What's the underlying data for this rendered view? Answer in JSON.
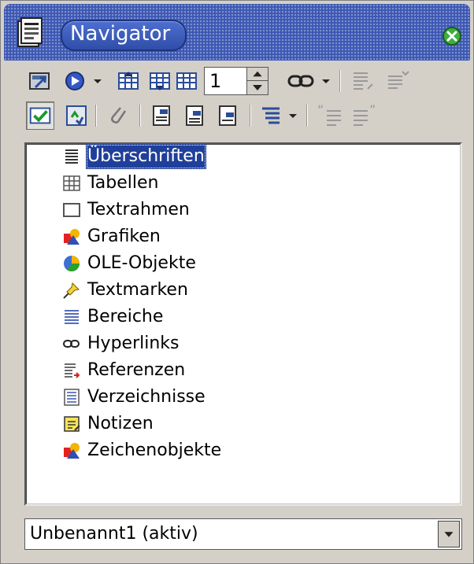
{
  "window": {
    "title": "Navigator",
    "colors": {
      "titlebar": "#3c57b3",
      "selection": "#1f3f9a",
      "background": "#d4d0c8"
    }
  },
  "toolbar": {
    "row1": [
      "toggle-icon",
      "navigation-icon",
      "dropdown-arrow-icon",
      "previous-icon",
      "next-icon",
      "anchor-icon"
    ],
    "page_spin_value": "1",
    "row1_right": [
      "hyperlink-icon",
      "dropdown-arrow-icon",
      "promote-level-icon",
      "demote-level-icon"
    ],
    "row2": [
      "content-view-icon",
      "update-icon",
      "reminder-icon",
      "header-icon",
      "footer-icon",
      "anchor-to-text-icon",
      "heading-levels-icon",
      "dropdown-arrow-icon",
      "promote-chapter-icon",
      "demote-chapter-icon"
    ]
  },
  "tree": {
    "items": [
      {
        "label": "Überschriften",
        "icon": "headings-icon",
        "selected": true
      },
      {
        "label": "Tabellen",
        "icon": "table-icon"
      },
      {
        "label": "Textrahmen",
        "icon": "frame-icon"
      },
      {
        "label": "Grafiken",
        "icon": "graphics-icon"
      },
      {
        "label": "OLE-Objekte",
        "icon": "ole-object-icon"
      },
      {
        "label": "Textmarken",
        "icon": "bookmark-icon"
      },
      {
        "label": "Bereiche",
        "icon": "sections-icon"
      },
      {
        "label": "Hyperlinks",
        "icon": "hyperlink-icon"
      },
      {
        "label": "Referenzen",
        "icon": "references-icon"
      },
      {
        "label": "Verzeichnisse",
        "icon": "indexes-icon"
      },
      {
        "label": "Notizen",
        "icon": "notes-icon"
      },
      {
        "label": "Zeichenobjekte",
        "icon": "drawing-objects-icon"
      }
    ]
  },
  "document_select": {
    "value": "Unbenannt1 (aktiv)"
  }
}
